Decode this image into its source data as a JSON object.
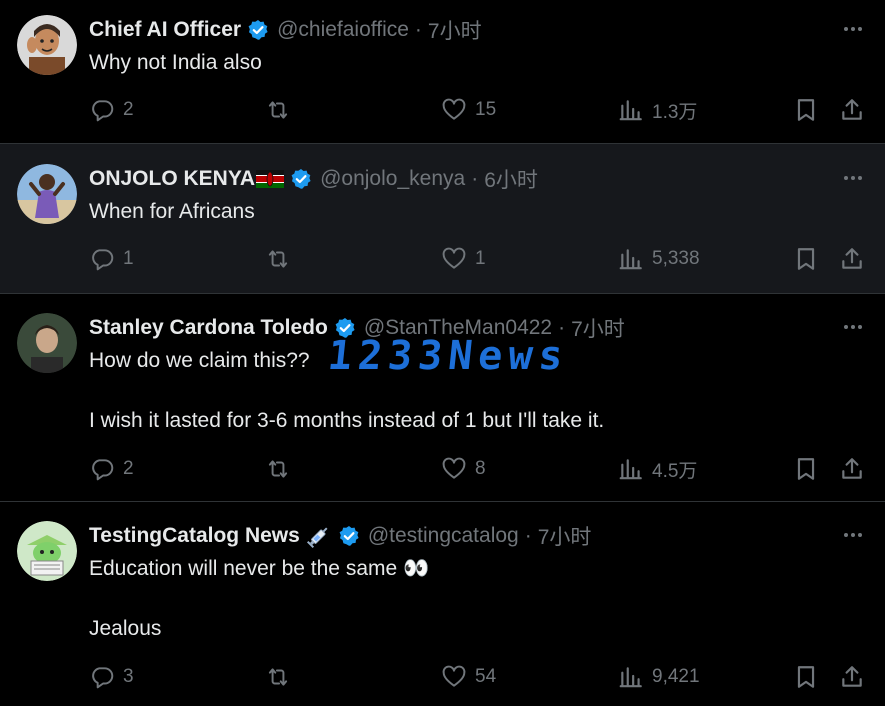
{
  "tweets": [
    {
      "name": "Chief AI Officer",
      "handle": "@chiefaioffice",
      "time": "7小时",
      "text": "Why not India also",
      "replies": "2",
      "retweets": "",
      "likes": "15",
      "views": "1.3万",
      "avatar_icon": "memoji-avatar"
    },
    {
      "name": "ONJOLO KENYA",
      "handle": "@onjolo_kenya",
      "time": "6小时",
      "text": "When for Africans",
      "replies": "1",
      "retweets": "",
      "likes": "1",
      "views": "5,338",
      "avatar_icon": "person-avatar"
    },
    {
      "name": "Stanley Cardona Toledo",
      "handle": "@StanTheMan0422",
      "time": "7小时",
      "text": "How do we claim this??\n\nI wish it lasted for 3-6 months instead of 1 but I'll take it.",
      "replies": "2",
      "retweets": "",
      "likes": "8",
      "views": "4.5万",
      "avatar_icon": "person-avatar"
    },
    {
      "name": "TestingCatalog News",
      "handle": "@testingcatalog",
      "time": "7小时",
      "text": "Education will never be the same 👀\n\nJealous",
      "replies": "3",
      "retweets": "",
      "likes": "54",
      "views": "9,421",
      "avatar_icon": "robot-avatar"
    }
  ],
  "watermark": "1233News",
  "colors": {
    "background": "#000000",
    "highlight_row": "#16181c",
    "text": "#e7e9ea",
    "muted": "#71767b",
    "verified": "#1d9bf0",
    "divider": "#2f3336"
  }
}
